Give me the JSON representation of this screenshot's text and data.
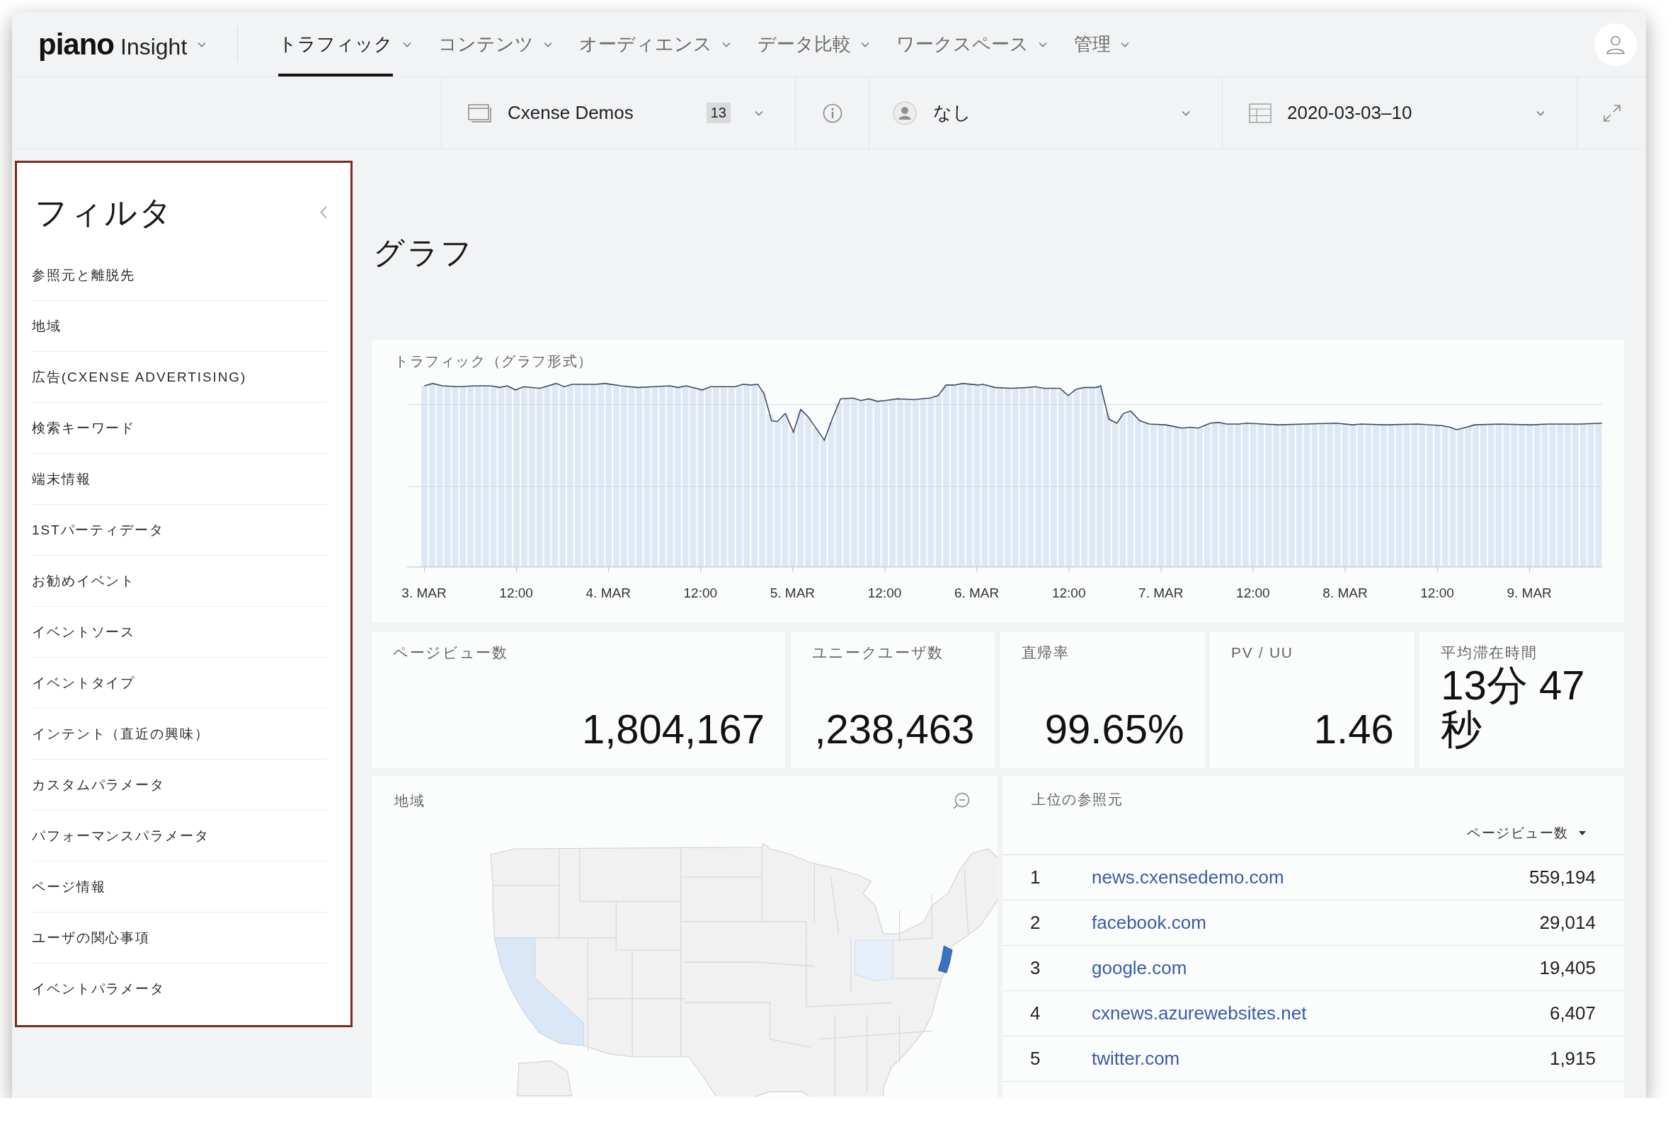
{
  "app": {
    "logo": "piano",
    "product": "Insight"
  },
  "nav": {
    "tabs": [
      {
        "label": "トラフィック",
        "selected": true
      },
      {
        "label": "コンテンツ",
        "selected": false
      },
      {
        "label": "オーディエンス",
        "selected": false
      },
      {
        "label": "データ比較",
        "selected": false
      },
      {
        "label": "ワークスペース",
        "selected": false
      },
      {
        "label": "管理",
        "selected": false
      }
    ]
  },
  "toolbar": {
    "site": {
      "name": "Cxense Demos",
      "count": "13"
    },
    "segment": {
      "value": "なし"
    },
    "date_range": {
      "value": "2020-03-03–10"
    }
  },
  "filters": {
    "title": "フィルタ",
    "items": [
      "参照元と離脱先",
      "地域",
      "広告(CXENSE ADVERTISING)",
      "検索キーワード",
      "端末情報",
      "1STパーティデータ",
      "お勧めイベント",
      "イベントソース",
      "イベントタイプ",
      "インテント（直近の興味）",
      "カスタムパラメータ",
      "パフォーマンスパラメータ",
      "ページ情報",
      "ユーザの関心事項",
      "イベントパラメータ"
    ]
  },
  "page_title": "グラフ",
  "traffic_chart": {
    "title": "トラフィック（グラフ形式）",
    "x_labels": [
      "3. MAR",
      "12:00",
      "4. MAR",
      "12:00",
      "5. MAR",
      "12:00",
      "6. MAR",
      "12:00",
      "7. MAR",
      "12:00",
      "8. MAR",
      "12:00",
      "9. MAR"
    ]
  },
  "metrics": [
    {
      "label": "ページビュー数",
      "value": "1,804,167"
    },
    {
      "label": "ユニークユーザ数",
      "value": ",238,463"
    },
    {
      "label": "直帰率",
      "value": "99.65%"
    },
    {
      "label": "PV / UU",
      "value": "1.46"
    },
    {
      "label": "平均滞在時間",
      "value": "13分 47 秒"
    }
  ],
  "region_map": {
    "title": "地域"
  },
  "top_referrers": {
    "title": "上位の参照元",
    "sort_column": "ページビュー数",
    "rows": [
      {
        "rank": "1",
        "domain": "news.cxensedemo.com",
        "pageviews": "559,194"
      },
      {
        "rank": "2",
        "domain": "facebook.com",
        "pageviews": "29,014"
      },
      {
        "rank": "3",
        "domain": "google.com",
        "pageviews": "19,405"
      },
      {
        "rank": "4",
        "domain": "cxnews.azurewebsites.net",
        "pageviews": "6,407"
      },
      {
        "rank": "5",
        "domain": "twitter.com",
        "pageviews": "1,915"
      }
    ]
  }
}
